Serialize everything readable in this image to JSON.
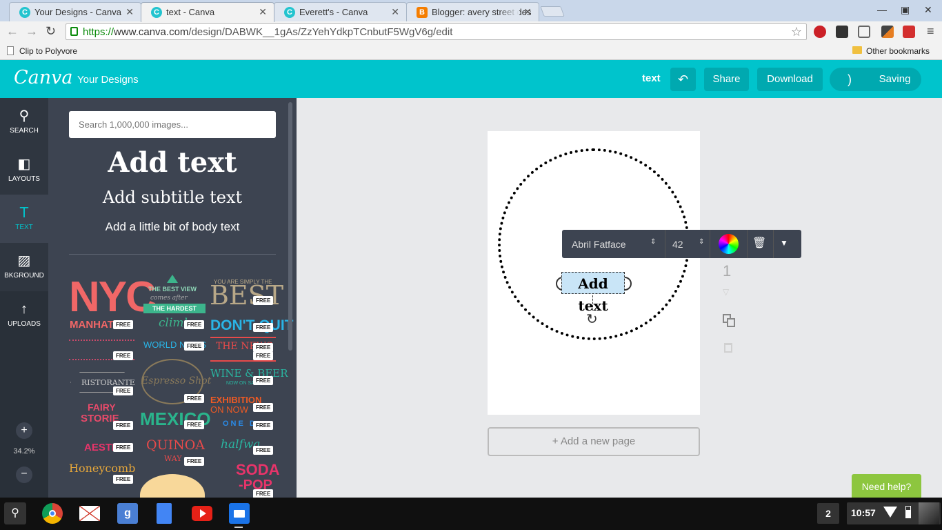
{
  "browser": {
    "tabs": [
      {
        "title": "Your Designs - Canva",
        "active": false
      },
      {
        "title": "text - Canva",
        "active": true
      },
      {
        "title": "Everett's - Canva",
        "active": false
      },
      {
        "title": "Blogger: avery street des",
        "active": false
      }
    ],
    "url_scheme": "https://",
    "url_host": "www.canva.com",
    "url_path": "/design/DABWK__1gAs/ZzYehYdkpTCnbutF5WgV6g/edit",
    "bookmarks": {
      "left": "Clip to Polyvore",
      "right": "Other bookmarks"
    }
  },
  "canva": {
    "logo": "Canva",
    "your_designs": "Your Designs",
    "doc_title": "text",
    "share": "Share",
    "download": "Download",
    "saving": "Saving",
    "rail": [
      {
        "label": "SEARCH",
        "icon": "search-icon"
      },
      {
        "label": "LAYOUTS",
        "icon": "layouts-icon"
      },
      {
        "label": "TEXT",
        "icon": "text-icon"
      },
      {
        "label": "BKGROUND",
        "icon": "background-icon"
      },
      {
        "label": "UPLOADS",
        "icon": "upload-icon"
      }
    ],
    "zoom": "34.2%",
    "search_placeholder": "Search 1,000,000 images...",
    "add_heading": "Add text",
    "add_subtitle": "Add subtitle text",
    "add_body": "Add a little bit of body text",
    "free_badge": "FREE",
    "templates": {
      "nyc": "NYC",
      "manhat": "MANHAT",
      "best_view": "THE BEST VIEW",
      "comes_after": "comes after",
      "hardest": "THE HARDEST",
      "climb": "climb",
      "best": "BEST",
      "you_are": "YOU ARE SIMPLY THE",
      "dont_quit": "DON'T QUIT",
      "world_news": "WORLD NEWS",
      "the_news": "THE NEWS",
      "ristorante": "RISTORANTE",
      "espresso": "Espresso Shot",
      "wine_beer": "WINE & BEER",
      "now_on_sale": "NOW ON SALE",
      "exhibition": "EXHIBITION",
      "on_now": "ON NOW",
      "fairy": "FAIRY",
      "stories": "STORIE",
      "mexico": "MEXICO",
      "one_d": "ONE D",
      "aesth": "AESTH",
      "quinoa": "QUINOA",
      "way": "WAY",
      "halfway": "halfwa",
      "honeycomb": "Honeycomb",
      "soda": "SODA",
      "pop": "-POP"
    },
    "canvas_text": "Add text",
    "font_name": "Abril Fatface",
    "font_size": "42",
    "page_number": "1",
    "add_page": "+ Add a new page",
    "need_help": "Need help?"
  },
  "shelf": {
    "notification_count": "2",
    "time": "10:57"
  },
  "colors": {
    "canva_teal": "#00c4cc",
    "rail_dark": "#293039",
    "panel": "#3d4451"
  }
}
